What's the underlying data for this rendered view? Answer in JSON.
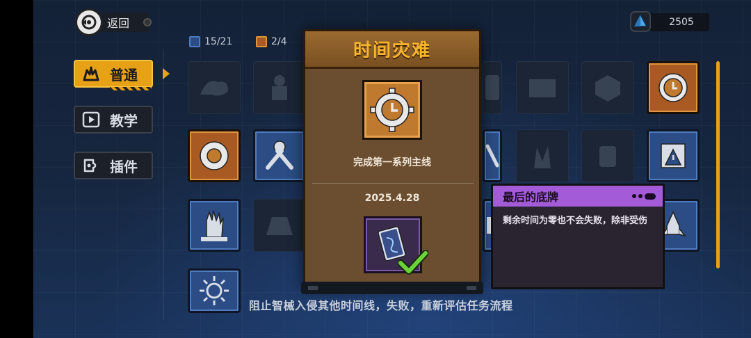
{
  "header": {
    "back_label": "返回",
    "currency_value": "2505"
  },
  "menu": {
    "items": [
      {
        "label": "普通",
        "active": true,
        "icon": "fist-icon"
      },
      {
        "label": "教学",
        "active": false,
        "icon": "play-icon"
      },
      {
        "label": "插件",
        "active": false,
        "icon": "plugin-icon"
      }
    ]
  },
  "counters": {
    "blue_count": "15/21",
    "orange_count": "2/4"
  },
  "modal": {
    "title": "时间灾难",
    "description": "完成第一系列主线",
    "date": "2025.4.28"
  },
  "tooltip": {
    "title": "最后的底牌",
    "description": "剩余时间为零也不会失败，除非受伤"
  },
  "footer_text": "阻止智械入侵其他时间线，失败，重新评估任务流程",
  "colors": {
    "accent": "#e6a117",
    "tile_blue": "#2b4c84",
    "tile_orange": "#a85a22",
    "tooltip_purple": "#a45bd8"
  }
}
